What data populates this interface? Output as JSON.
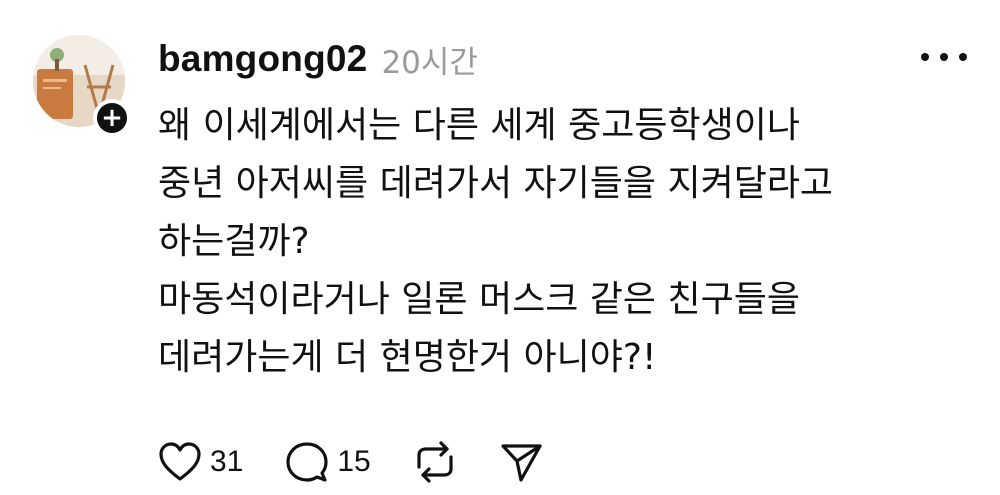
{
  "post": {
    "username": "bamgong02",
    "time": "20시간",
    "lines": [
      "왜 이세계에서는 다른 세계 중고등학생이나",
      "중년 아저씨를 데려가서 자기들을 지켜달라고",
      "하는걸까?",
      "마동석이라거나 일론 머스크 같은 친구들을",
      "데려가는게 더 현명한거 아니야?!"
    ]
  },
  "avatar": {
    "icon": "profile-photo",
    "badge_icon": "plus-icon",
    "badge_symbol": "+"
  },
  "menu": {
    "icon": "more-dots-icon"
  },
  "actions": {
    "like": {
      "icon": "heart-icon",
      "count": "31"
    },
    "comment": {
      "icon": "comment-bubble-icon",
      "count": "15"
    },
    "repost": {
      "icon": "repost-icon"
    },
    "share": {
      "icon": "share-send-icon"
    }
  },
  "colors": {
    "text": "#111111",
    "muted": "#9a9a9a",
    "background": "#ffffff",
    "avatar_accent": "#c97a3f"
  }
}
